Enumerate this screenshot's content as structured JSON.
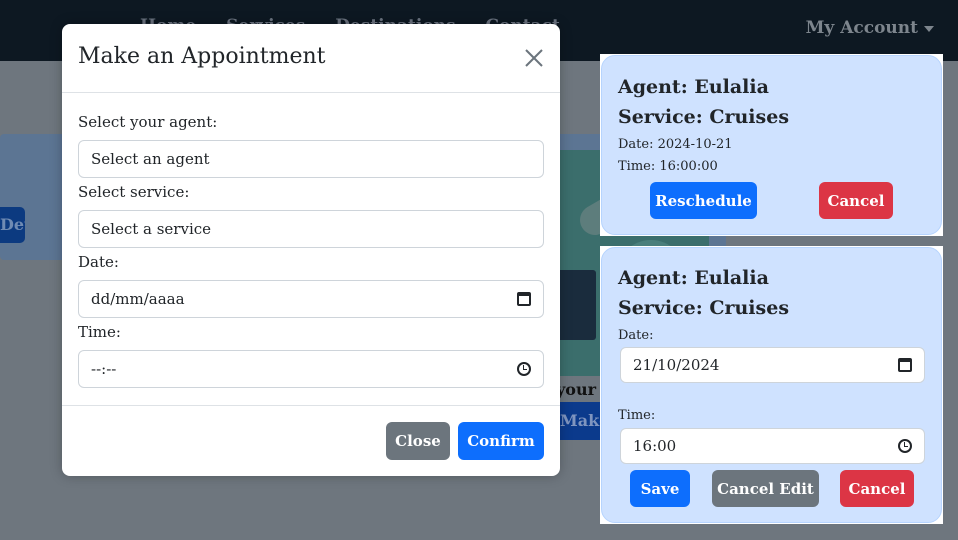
{
  "navbar": {
    "links": [
      "Home",
      "Services",
      "Destinations",
      "Contact"
    ],
    "account_label": "My Account"
  },
  "background": {
    "card_button_label": "Details",
    "image_caption": "your next",
    "card_cta_label": "Make an appointment"
  },
  "modal": {
    "title": "Make an Appointment",
    "agent_label": "Select your agent:",
    "agent_value": "Select an agent",
    "service_label": "Select service:",
    "service_value": "Select a service",
    "date_label": "Date:",
    "date_placeholder": "dd/mm/aaaa",
    "time_label": "Time:",
    "time_placeholder": "--:--",
    "close_label": "Close",
    "confirm_label": "Confirm"
  },
  "appointments": [
    {
      "agent": "Agent: Eulalia",
      "service": "Service: Cruises",
      "date": "Date: 2024-10-21",
      "time": "Time: 16:00:00",
      "reschedule_label": "Reschedule",
      "cancel_label": "Cancel"
    },
    {
      "agent": "Agent: Eulalia",
      "service": "Service: Cruises",
      "date_label": "Date:",
      "date_value": "21/10/2024",
      "time_label": "Time:",
      "time_value": "16:00",
      "save_label": "Save",
      "cancel_edit_label": "Cancel Edit",
      "cancel_label": "Cancel"
    }
  ],
  "colors": {
    "primary": "#0d6efd",
    "secondary": "#6c757d",
    "danger": "#dc3545",
    "card_bg": "#cfe2ff",
    "navbar": "#0d1822",
    "backdrop": "#6e767e"
  }
}
